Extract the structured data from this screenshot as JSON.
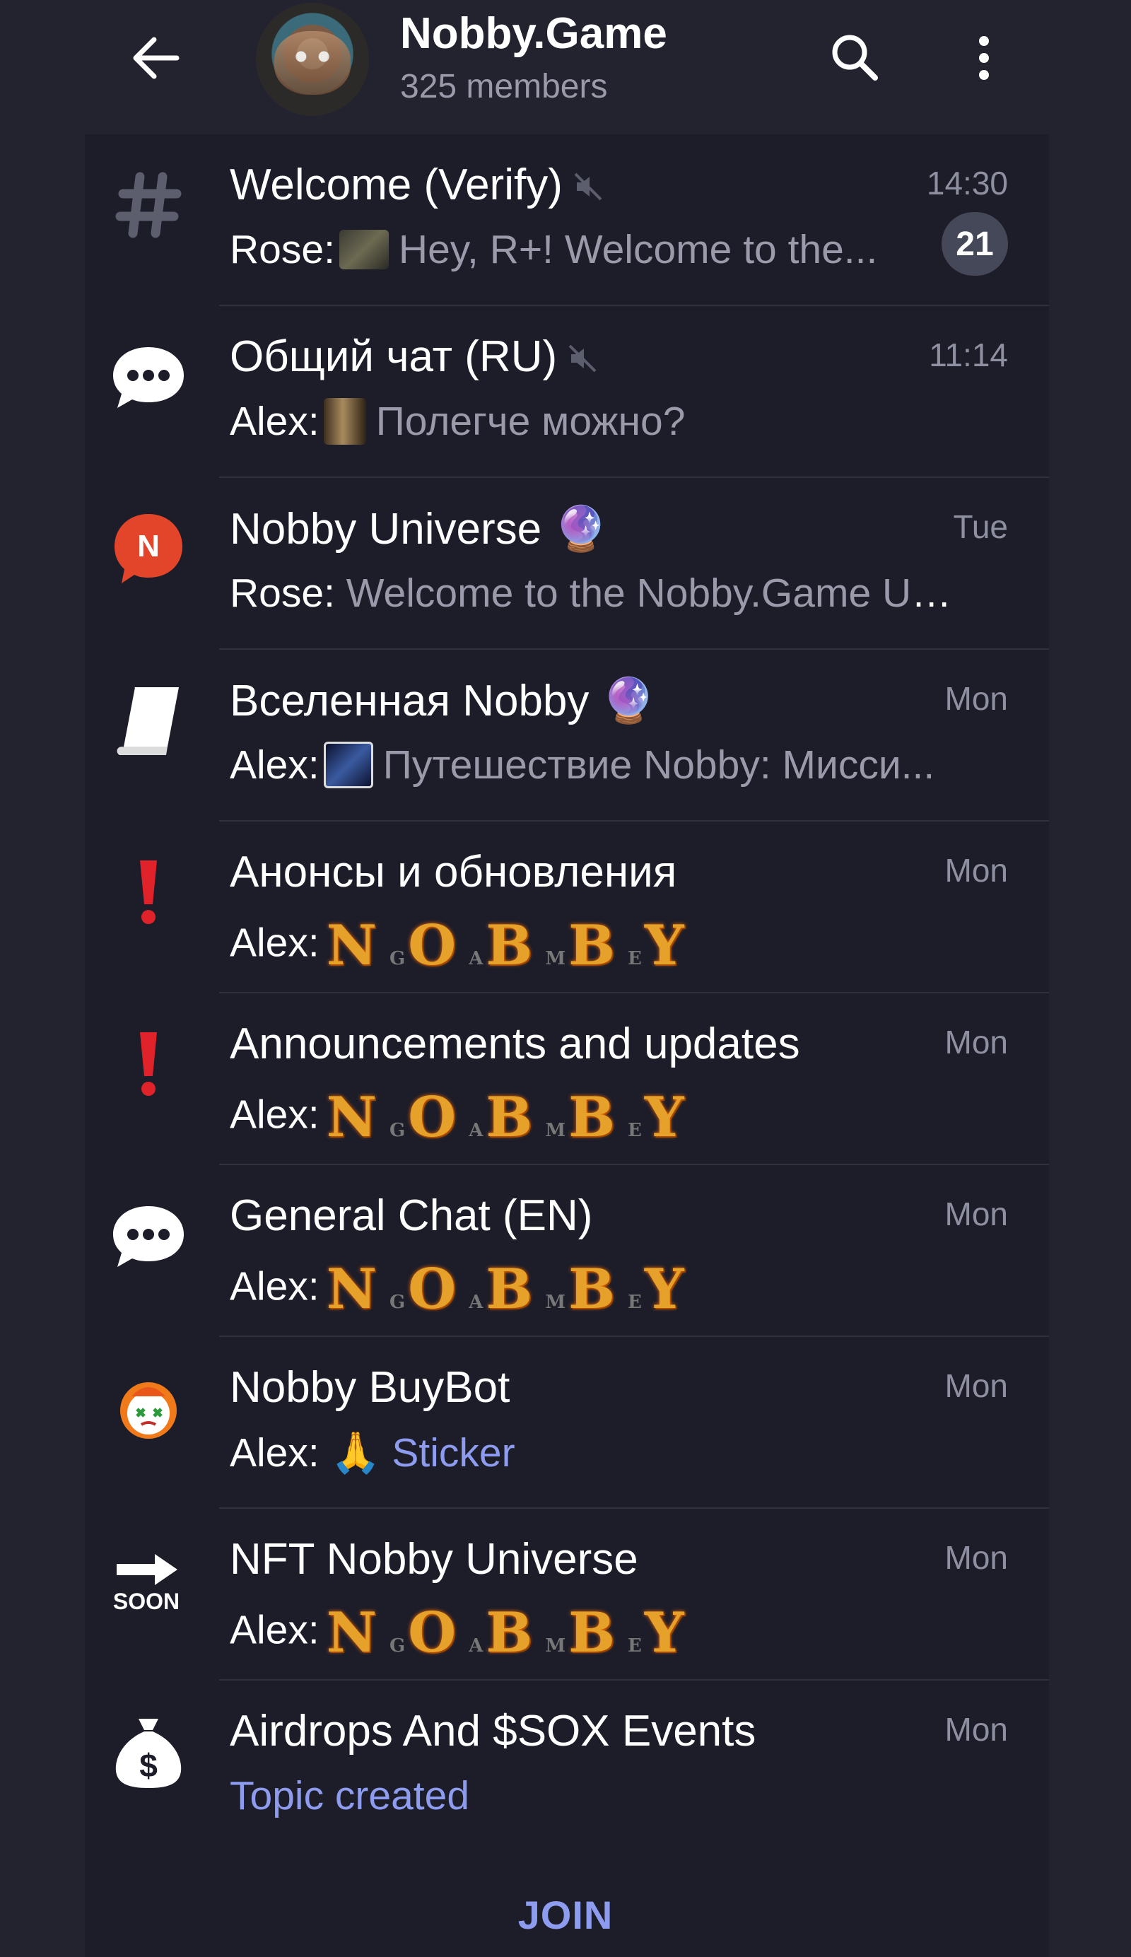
{
  "header": {
    "title": "Nobby.Game",
    "subtitle": "325 members"
  },
  "topics": [
    {
      "name": "Welcome (Verify)",
      "muted": true,
      "time": "14:30",
      "sender": "Rose:",
      "message": "Hey, R+!  Welcome to the...",
      "badge": "21",
      "icon": "hashtag-icon"
    },
    {
      "name": "Общий чат (RU)",
      "muted": true,
      "time": "11:14",
      "sender": "Alex:",
      "message": "Полегче можно?",
      "icon": "speech-bubble-icon"
    },
    {
      "name": "Nobby Universe 🔮",
      "time": "Tue",
      "sender": "Rose:",
      "message": "Welcome to the Nobby.Game Un...",
      "icon": "n-bubble-icon"
    },
    {
      "name": "Вселенная Nobby 🔮",
      "time": "Mon",
      "sender": "Alex:",
      "message": "Путешествие Nobby: Мисси...",
      "icon": "book-icon"
    },
    {
      "name": "Анонсы и обновления",
      "time": "Mon",
      "sender": "Alex:",
      "icon": "exclamation-icon"
    },
    {
      "name": "Announcements and updates",
      "time": "Mon",
      "sender": "Alex:",
      "icon": "exclamation-icon"
    },
    {
      "name": "General Chat (EN)",
      "time": "Mon",
      "sender": "Alex:",
      "icon": "speech-bubble-icon"
    },
    {
      "name": "Nobby BuyBot",
      "time": "Mon",
      "sender": "Alex:",
      "message": "🙏 ",
      "accent": "Sticker",
      "icon": "buybot-icon"
    },
    {
      "name": "NFT Nobby Universe",
      "time": "Mon",
      "sender": "Alex:",
      "icon": "soon-arrow-icon"
    },
    {
      "name": "Airdrops And $SOX Events",
      "time": "Mon",
      "accent": "Topic created",
      "icon": "money-bag-icon"
    }
  ],
  "nobby_logo": {
    "big": [
      "N",
      "O",
      "B",
      "B",
      "Y"
    ],
    "small": [
      "G",
      "A",
      "M",
      "E"
    ]
  },
  "soon_label": "SOON",
  "n_label": "N",
  "join_label": "JOIN"
}
